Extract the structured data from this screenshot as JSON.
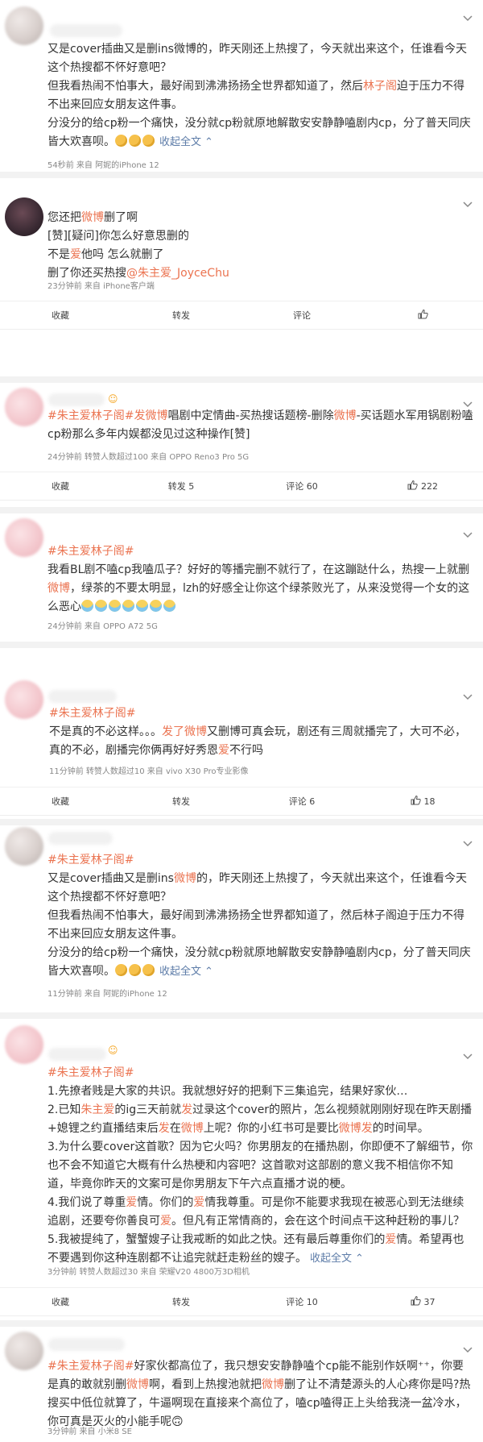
{
  "posts": [
    {
      "paras": [
        [
          "又是cover插曲又是删ins微博的，昨天刚还上热搜了，今天就出来这个，任谁看今天这个热搜都不怀好意吧？"
        ],
        [
          "但我看热闹不怕事大，最好闹到沸沸扬扬全世界都知道了，然后",
          "林子阁",
          "迫于压力不得不出来回应女朋友这件事。"
        ],
        [
          "分没分的给cp粉一个痛快，没分就cp粉就原地解散安安静静嗑剧内cp，分了普天同庆皆大欢喜呗。"
        ]
      ],
      "expand_label": "收起全文",
      "meta": "54秒前  来自 阿妮的iPhone 12"
    },
    {
      "lines": [
        "您还把",
        "微博",
        "删了啊",
        "[赞][疑问]你怎么好意思删的",
        "不是",
        "爱",
        "他吗 怎么就删了",
        "删了你还买热搜",
        "@朱主爱_JoyceChu"
      ],
      "meta": "23分钟前  来自 iPhone客户端",
      "actions": {
        "collect": "收藏",
        "repost": "转发",
        "comment": "评论"
      }
    },
    {
      "topic1": "#朱主爱林子阁#",
      "text1": "发",
      "kw1": "微博",
      "text2": "唱剧中定情曲-买热搜话题榜-删除",
      "kw2": "微博",
      "text3": "-买话题水军用锅剧粉嗑cp粉那么多年内娱都没见过这种操作[赞]",
      "meta": "24分钟前  转赞人数超过100  来自 OPPO Reno3 Pro 5G",
      "actions": {
        "collect": "收藏",
        "repost": "转发 5",
        "comment": "评论 60",
        "like": "222"
      }
    },
    {
      "topic": "#朱主爱林子阁#",
      "text1": "我看BL剧不嗑cp我嗑瓜子？好好的等播完删不就行了，在这蹦跶什么，热搜一上就删",
      "kw": "微博",
      "text2": "，绿茶的不要太明显，lzh的好感全让你这个绿茶败光了，从来没觉得一个女的这么恶心",
      "meta": "24分钟前  来自 OPPO A72 5G"
    },
    {
      "topic": "#朱主爱林子阁#",
      "text1": "不是真的不必这样。。。",
      "kw1": "发了",
      "kw2": "微博",
      "text2": "又删博可真会玩，剧还有三周就播完了，大可不必，真的不必，剧播完你俩再好好秀恩",
      "kw3": "爱",
      "text3": "不行吗",
      "meta": "11分钟前  转赞人数超过10  来自 vivo X30 Pro专业影像",
      "actions": {
        "collect": "收藏",
        "repost": "转发",
        "comment": "评论 6",
        "like": "18"
      }
    },
    {
      "topic": "#朱主爱林子阁#",
      "line1a": "又是cover插曲又是删ins",
      "kw": "微博",
      "line1b": "的，昨天刚还上热搜了，今天就出来这个，任谁看今天这个热搜都不怀好意吧？",
      "line2": "但我看热闹不怕事大，最好闹到沸沸扬扬全世界都知道了，然后林子阁迫于压力不得不出来回应女朋友这件事。",
      "line3": "分没分的给cp粉一个痛快，没分就cp粉就原地解散安安静静嗑剧内cp，分了普天同庆皆大欢喜呗。",
      "expand_label": "收起全文",
      "meta": "11分钟前  来自 阿妮的iPhone 12"
    },
    {
      "topic": "#朱主爱林子阁#",
      "p1": "1.先撩者贱是大家的共识。我就想好好的把剩下三集追完，结果好家伙…",
      "p2a": "2.已知",
      "p2k1": "朱主爱",
      "p2b": "的ig三天前就",
      "p2k2": "发",
      "p2c": "过录这个cover的照片，怎么视频就刚刚好现在昨天剧播+媳锂之约直播结束后",
      "p2k3": "发",
      "p2d": "在",
      "p2k4": "微博",
      "p2e": "上呢？你的小红书可是要比",
      "p2k5": "微博发",
      "p2f": "的时间早。",
      "p3": "3.为什么要cover这首歌？因为它火吗？你男朋友的在播热剧，你即便不了解细节，你也不会不知道它大概有什么热梗和内容吧？这首歌对这部剧的意义我不相信你不知道，毕竟你昨天的文案可是你男朋友下午六点直播才说的梗。",
      "p4a": "4.我们说了尊重",
      "p4k1": "爱",
      "p4b": "情。你们的",
      "p4k2": "爱",
      "p4c": "情我尊重。可是你不能要求我现在被恶心到无法继续追剧，还要夸你善良可",
      "p4k3": "爱",
      "p4d": "。但凡有正常情商的，会在这个时间点干这种赶粉的事儿？",
      "p5a": "5.我被提纯了，蟹蟹嫂子让我戒断的如此之快。还有最后尊重你们的",
      "p5k": "爱",
      "p5b": "情。希望再也不要遇到你这种连剧都不让追完就赶走粉丝的嫂子。",
      "expand_label": "收起全文",
      "meta": "3分钟前  转赞人数超过30  来自 荣耀V20 4800万3D相机",
      "actions": {
        "collect": "收藏",
        "repost": "转发",
        "comment": "评论 10",
        "like": "37"
      }
    },
    {
      "topic": "#朱主爱林子阁#",
      "t1": "好家伙都高位了，我只想安安静静嗑个cp能不能别作妖啊⁺⁺，你要是真的敢就别删",
      "k1": "微博",
      "t2": "啊，看到上热搜池就把",
      "k2": "微博",
      "t3": "删了让不清楚源头的人心疼你是吗?热搜买中低位就算了，牛逼啊现在直接来个高位了，嗑cp嗑得正上头给我浇一盆冷水，你可真是灭火的小能手呢🙃",
      "meta": "3分钟前  来自 小米8 SE"
    }
  ],
  "icons": {
    "chevron": "chevron-down-icon",
    "like": "thumbs-up-icon",
    "emoji_clap": "clap-emoji-icon",
    "emoji_cry": "crying-emoji-icon"
  },
  "colors": {
    "keyword": "#eb7350",
    "link": "#5d7ca8",
    "meta": "#888888",
    "divider": "#f2f2f2"
  }
}
